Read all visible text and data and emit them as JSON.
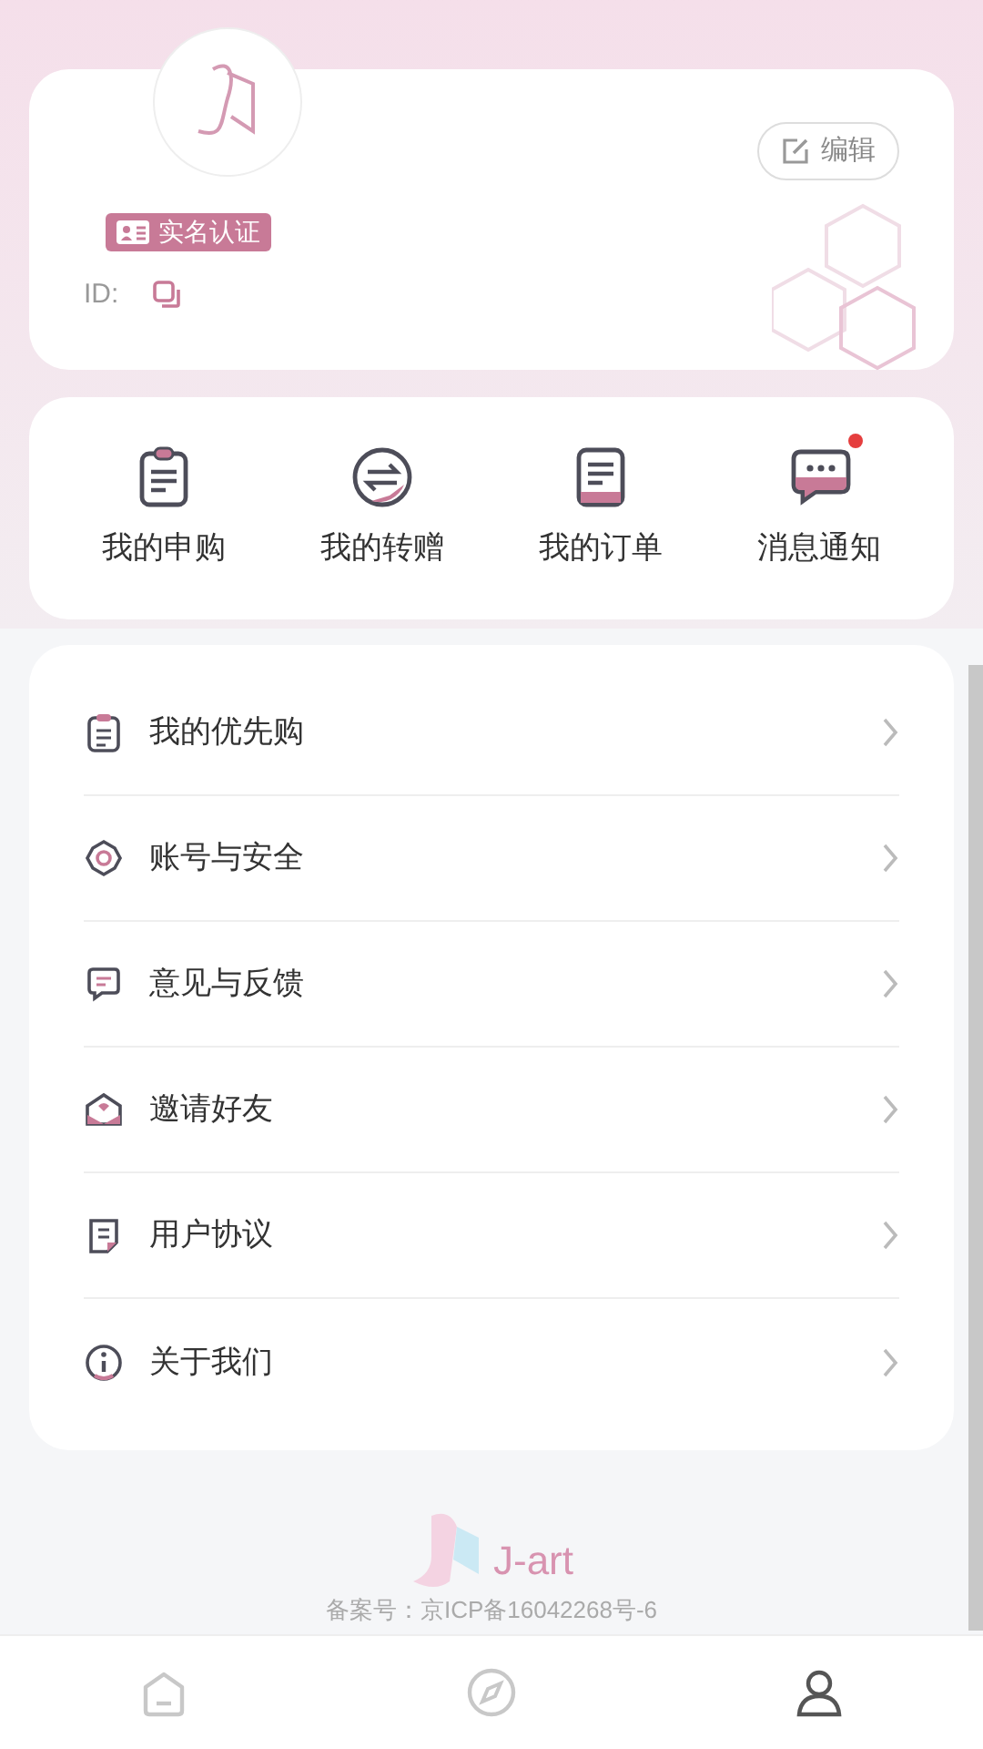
{
  "profile": {
    "verify_badge": "实名认证",
    "id_label": "ID:",
    "edit_button": "编辑"
  },
  "shortcuts": [
    {
      "label": "我的申购",
      "badge": false
    },
    {
      "label": "我的转赠",
      "badge": false
    },
    {
      "label": "我的订单",
      "badge": false
    },
    {
      "label": "消息通知",
      "badge": true
    }
  ],
  "menu": [
    {
      "label": "我的优先购"
    },
    {
      "label": "账号与安全"
    },
    {
      "label": "意见与反馈"
    },
    {
      "label": "邀请好友"
    },
    {
      "label": "用户协议"
    },
    {
      "label": "关于我们"
    }
  ],
  "footer": {
    "brand": "J-art",
    "record": "备案号：京ICP备16042268号-6"
  },
  "tab_bar": [
    {
      "selected": false
    },
    {
      "selected": false
    },
    {
      "selected": true
    }
  ]
}
